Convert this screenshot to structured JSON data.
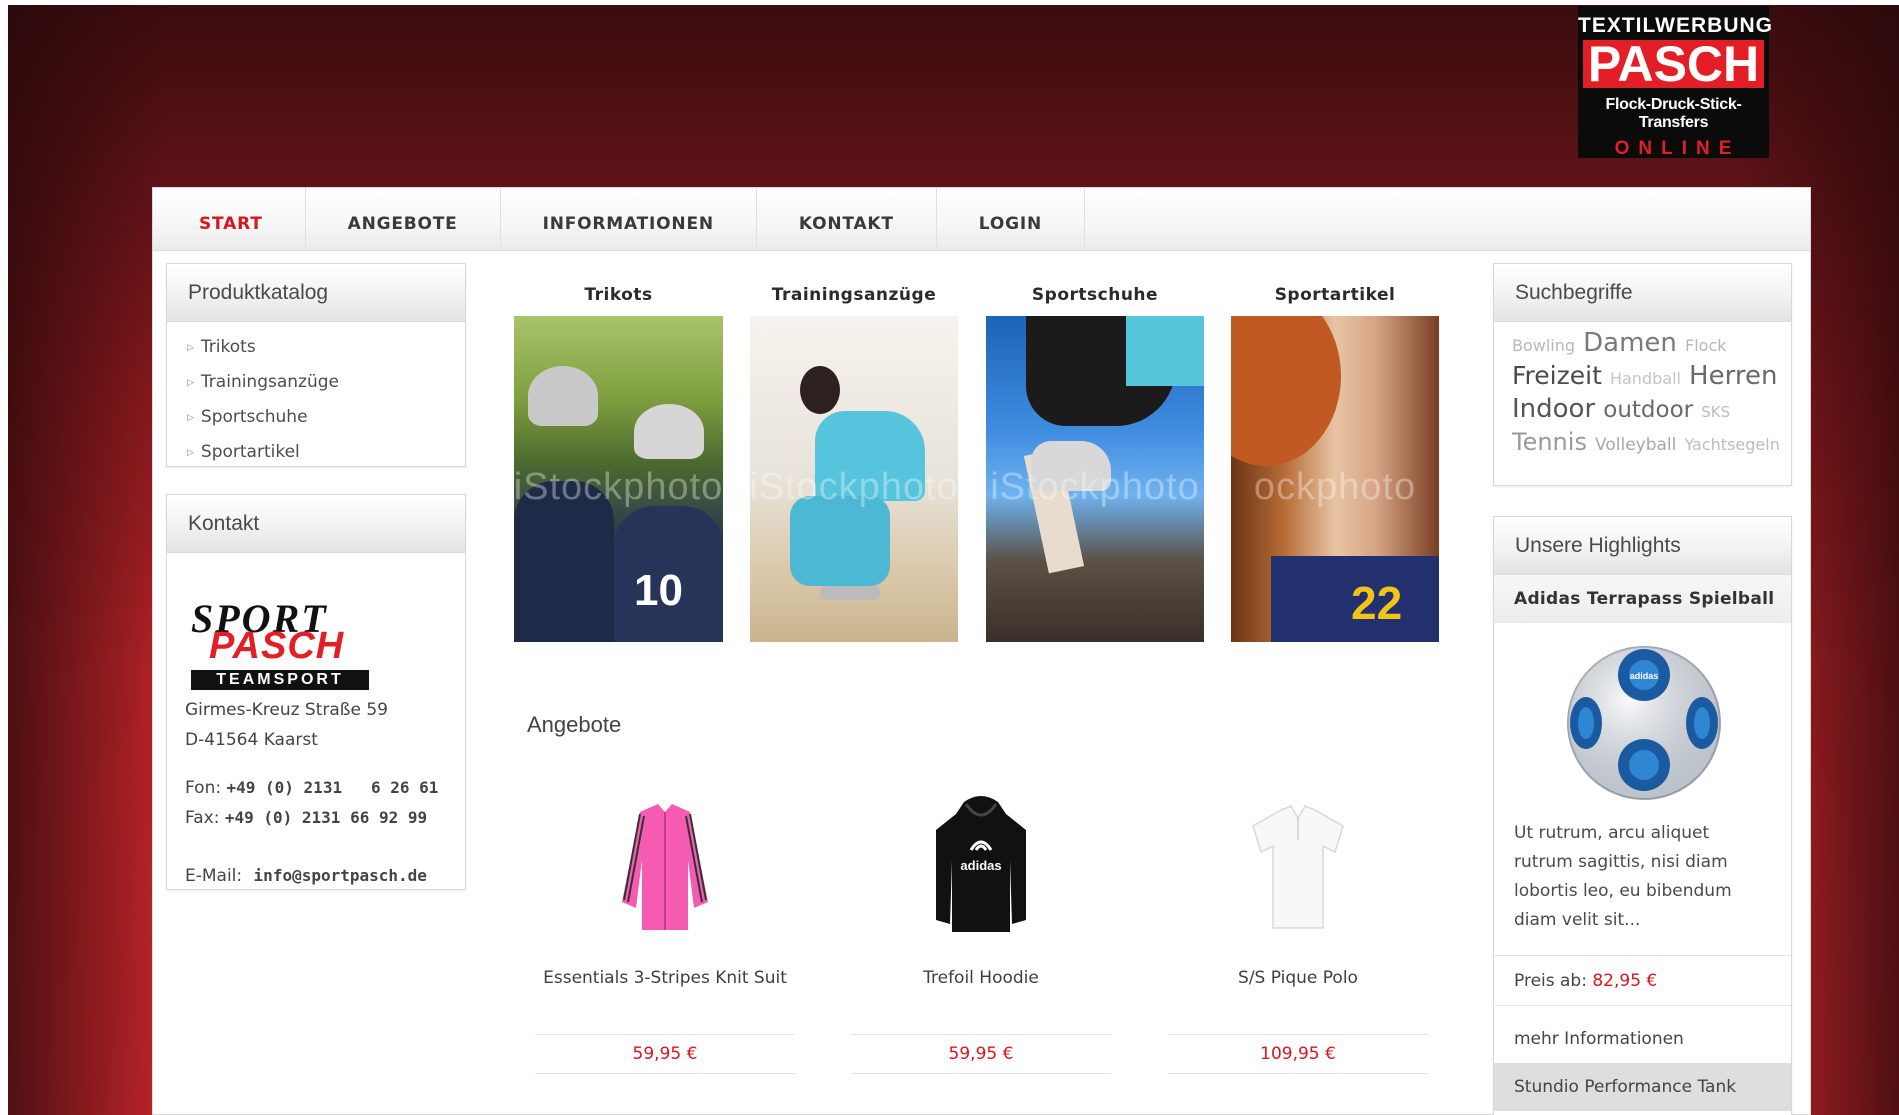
{
  "brand_logo": {
    "line1": "TEXTILWERBUNG",
    "line2": "PASCH",
    "line3": "Flock-Druck-Stick-Transfers",
    "line4": "ONLINE"
  },
  "nav": {
    "items": [
      "START",
      "ANGEBOTE",
      "INFORMATIONEN",
      "KONTAKT",
      "LOGIN"
    ],
    "active": "START",
    "active_color": "#d8161c"
  },
  "produktkatalog": {
    "title": "Produktkatalog",
    "items": [
      "Trikots",
      "Trainingsanzüge",
      "Sportschuhe",
      "Sportartikel"
    ]
  },
  "kontakt": {
    "title": "Kontakt",
    "logo": {
      "top": "SPORT",
      "mid": "PASCH",
      "bottom": "TEAMSPORT"
    },
    "street": "Girmes-Kreuz Straße 59",
    "city": "D-41564 Kaarst",
    "fon_label": "Fon:",
    "fon_value": "+49 (0) 2131   6 26 61",
    "fax_label": "Fax:",
    "fax_value": "+49 (0) 2131 66 92 99",
    "email_label": "E-Mail:",
    "email_value": "info@sportpasch.de"
  },
  "categories": [
    {
      "title": "Trikots",
      "watermark": "iStockphoto"
    },
    {
      "title": "Trainingsanzüge",
      "watermark": "iStockphoto"
    },
    {
      "title": "Sportschuhe",
      "watermark": "iStockphoto"
    },
    {
      "title": "Sportartikel",
      "watermark": "ockphoto"
    }
  ],
  "angebote": {
    "title": "Angebote",
    "items": [
      {
        "name": "Essentials 3-Stripes Knit Suit",
        "price": "59,95 €",
        "icon": "pink-jacket-icon"
      },
      {
        "name": "Trefoil Hoodie",
        "price": "59,95 €",
        "icon": "black-hoodie-icon"
      },
      {
        "name": "S/S Pique Polo",
        "price": "109,95 €",
        "icon": "white-polo-icon"
      }
    ]
  },
  "suchbegriffe": {
    "title": "Suchbegriffe",
    "tags": [
      {
        "text": "Bowling",
        "size": 16,
        "color": "#b8b8b8"
      },
      {
        "text": "Damen",
        "size": 26,
        "color": "#7a7a7a"
      },
      {
        "text": "Flock",
        "size": 16,
        "color": "#b8b8b8"
      },
      {
        "text": "Freizeit",
        "size": 25,
        "color": "#4a4a4a"
      },
      {
        "text": "Handball",
        "size": 16,
        "color": "#c4c4c4"
      },
      {
        "text": "Herren",
        "size": 26,
        "color": "#6a6a6a"
      },
      {
        "text": "Indoor",
        "size": 26,
        "color": "#555555"
      },
      {
        "text": "outdoor",
        "size": 23,
        "color": "#6a6a6a"
      },
      {
        "text": "SKS",
        "size": 15,
        "color": "#bcbcbc"
      },
      {
        "text": "Tennis",
        "size": 24,
        "color": "#9a9a9a"
      },
      {
        "text": "Volleyball",
        "size": 17,
        "color": "#a8a8a8"
      },
      {
        "text": "Yachtsegeln",
        "size": 16,
        "color": "#bcbcbc"
      }
    ]
  },
  "highlights": {
    "title": "Unsere Highlights",
    "item_title": "Adidas Terrapass Spielball",
    "description": "Ut rutrum, arcu aliquet rutrum sagittis, nisi diam lobortis leo, eu bibendum diam velit sit...",
    "price_label": "Preis ab:",
    "price_value": "82,95 €",
    "more_link": "mehr Informationen",
    "next_title": "Stundio Performance Tank"
  }
}
